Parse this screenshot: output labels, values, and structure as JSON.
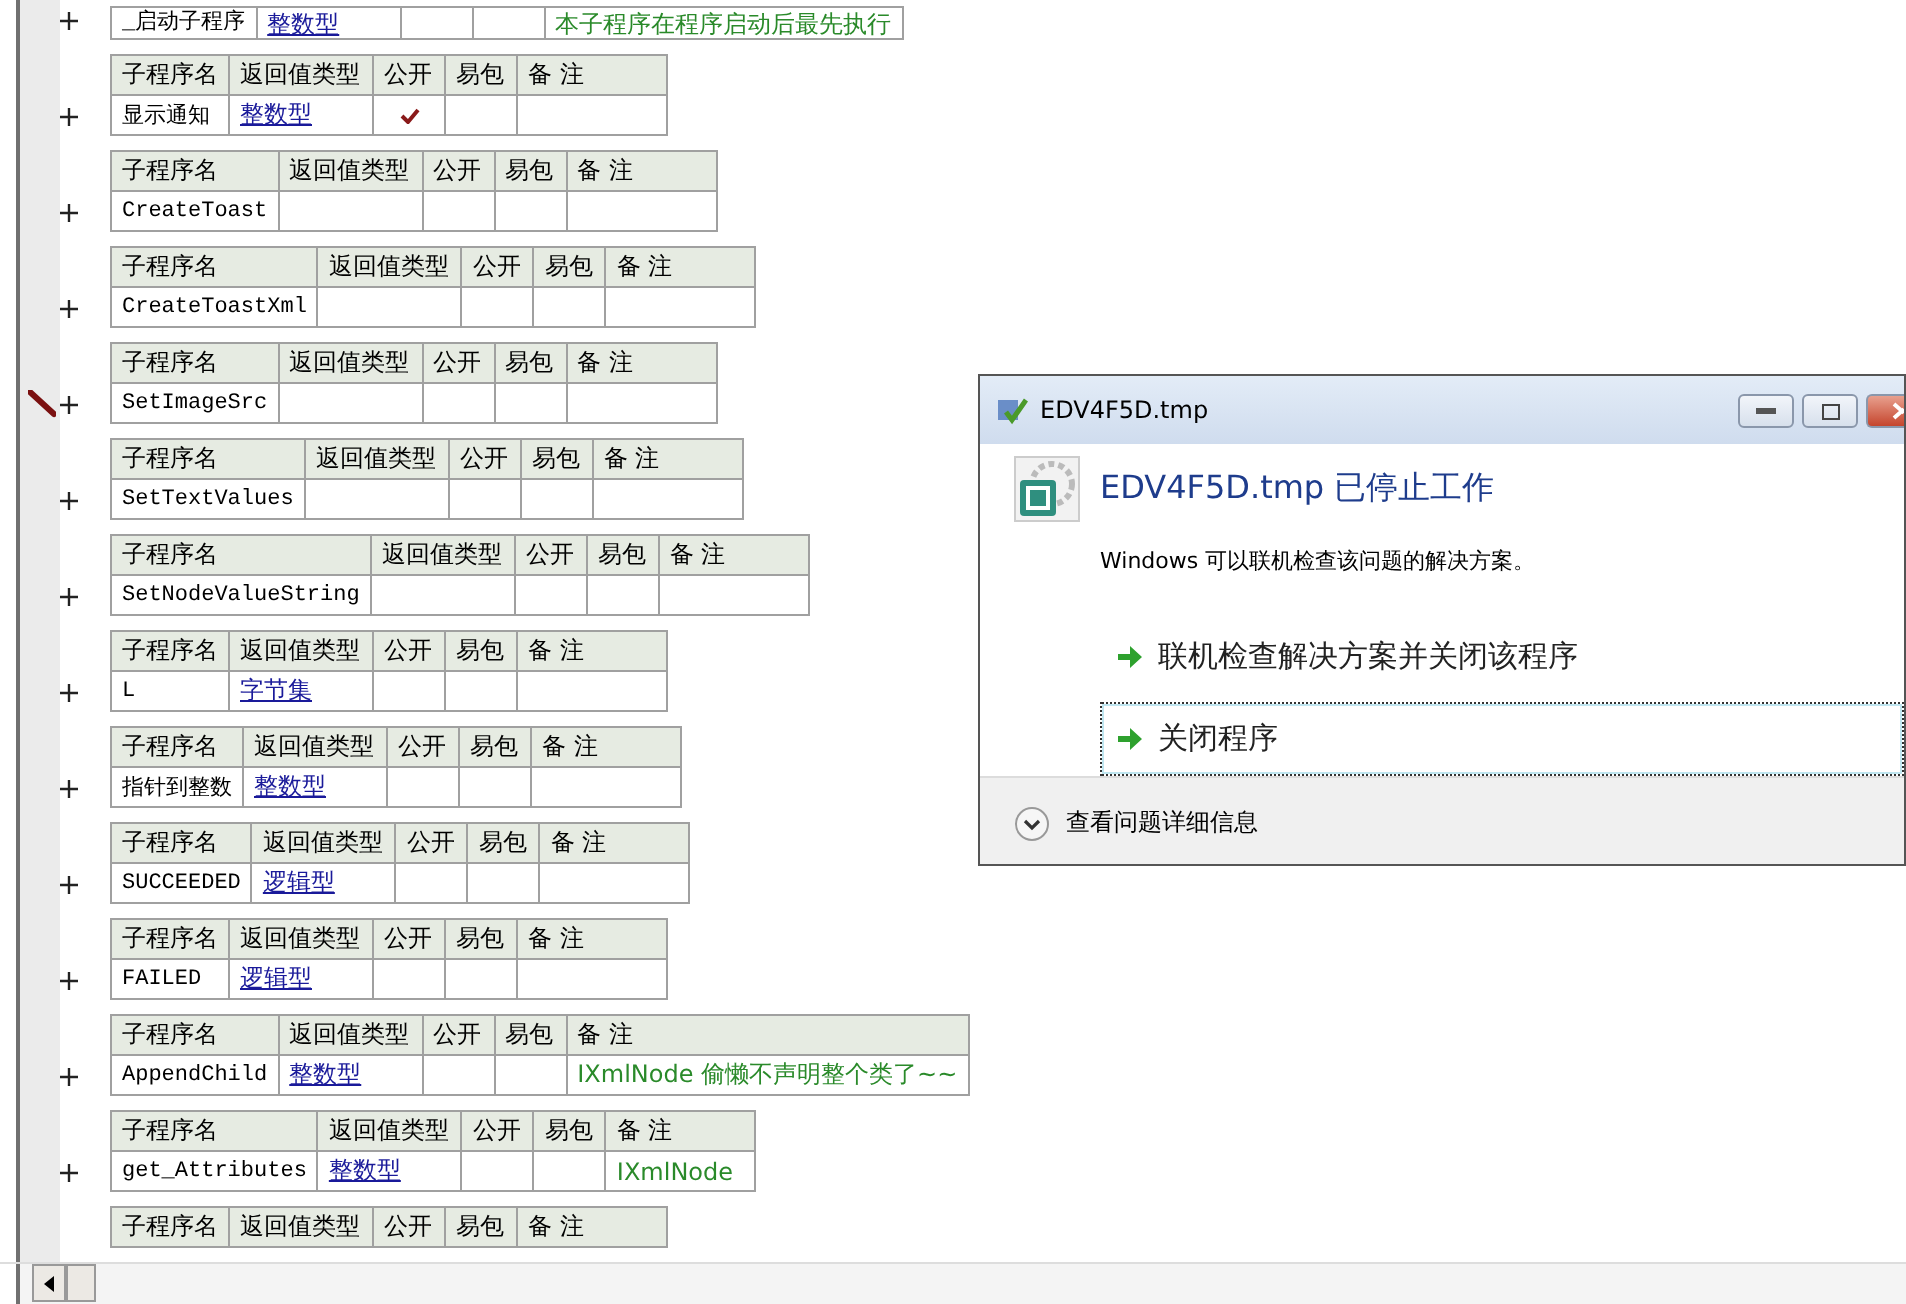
{
  "tables": [
    {
      "kind": "row_only",
      "name": "_启动子程序",
      "return_type": "整数型",
      "public": false,
      "note": "本子程序在程序启动后最先执行",
      "editing": false
    },
    {
      "kind": "full",
      "columns": [
        "子程序名",
        "返回值类型",
        "公开",
        "易包",
        "备 注"
      ],
      "name": "显示通知",
      "return_type": "整数型",
      "public": true,
      "editing": false
    },
    {
      "kind": "full",
      "columns": [
        "子程序名",
        "返回值类型",
        "公开",
        "易包",
        "备 注"
      ],
      "name": "CreateToast",
      "public": false,
      "editing": false
    },
    {
      "kind": "full",
      "columns": [
        "子程序名",
        "返回值类型",
        "公开",
        "易包",
        "备 注"
      ],
      "name": "CreateToastXml",
      "public": false,
      "editing": false
    },
    {
      "kind": "full",
      "columns": [
        "子程序名",
        "返回值类型",
        "公开",
        "易包",
        "备 注"
      ],
      "name": "SetImageSrc",
      "public": false,
      "editing": true
    },
    {
      "kind": "full",
      "columns": [
        "子程序名",
        "返回值类型",
        "公开",
        "易包",
        "备 注"
      ],
      "name": "SetTextValues",
      "public": false,
      "editing": false
    },
    {
      "kind": "full",
      "columns": [
        "子程序名",
        "返回值类型",
        "公开",
        "易包",
        "备 注"
      ],
      "name": "SetNodeValueString",
      "public": false,
      "editing": false
    },
    {
      "kind": "full",
      "columns": [
        "子程序名",
        "返回值类型",
        "公开",
        "易包",
        "备 注"
      ],
      "name": "L",
      "return_type": "字节集",
      "public": false,
      "editing": false
    },
    {
      "kind": "full",
      "columns": [
        "子程序名",
        "返回值类型",
        "公开",
        "易包",
        "备 注"
      ],
      "name": "指针到整数",
      "return_type": "整数型",
      "public": false,
      "editing": false
    },
    {
      "kind": "full",
      "columns": [
        "子程序名",
        "返回值类型",
        "公开",
        "易包",
        "备 注"
      ],
      "name": "SUCCEEDED",
      "return_type": "逻辑型",
      "public": false,
      "editing": false
    },
    {
      "kind": "full",
      "columns": [
        "子程序名",
        "返回值类型",
        "公开",
        "易包",
        "备 注"
      ],
      "name": "FAILED",
      "return_type": "逻辑型",
      "public": false,
      "editing": false
    },
    {
      "kind": "full",
      "columns": [
        "子程序名",
        "返回值类型",
        "公开",
        "易包",
        "备 注"
      ],
      "name": "AppendChild",
      "return_type": "整数型",
      "public": false,
      "note": "IXmlNode 偷懒不声明整个类了~~",
      "editing": false
    },
    {
      "kind": "full",
      "columns": [
        "子程序名",
        "返回值类型",
        "公开",
        "易包",
        "备 注"
      ],
      "name": "get_Attributes",
      "return_type": "整数型",
      "public": false,
      "note": "IXmlNode",
      "editing": false
    },
    {
      "kind": "header_only",
      "columns": [
        "子程序名",
        "返回值类型",
        "公开",
        "易包",
        "备 注"
      ]
    }
  ],
  "dialog": {
    "title": "EDV4F5D.tmp",
    "heading": "EDV4F5D.tmp 已停止工作",
    "message": "Windows 可以联机检查该问题的解决方案。",
    "options": [
      {
        "label": "联机检查解决方案并关闭该程序",
        "focused": false
      },
      {
        "label": "关闭程序",
        "focused": true
      }
    ],
    "details": "查看问题详细信息"
  }
}
